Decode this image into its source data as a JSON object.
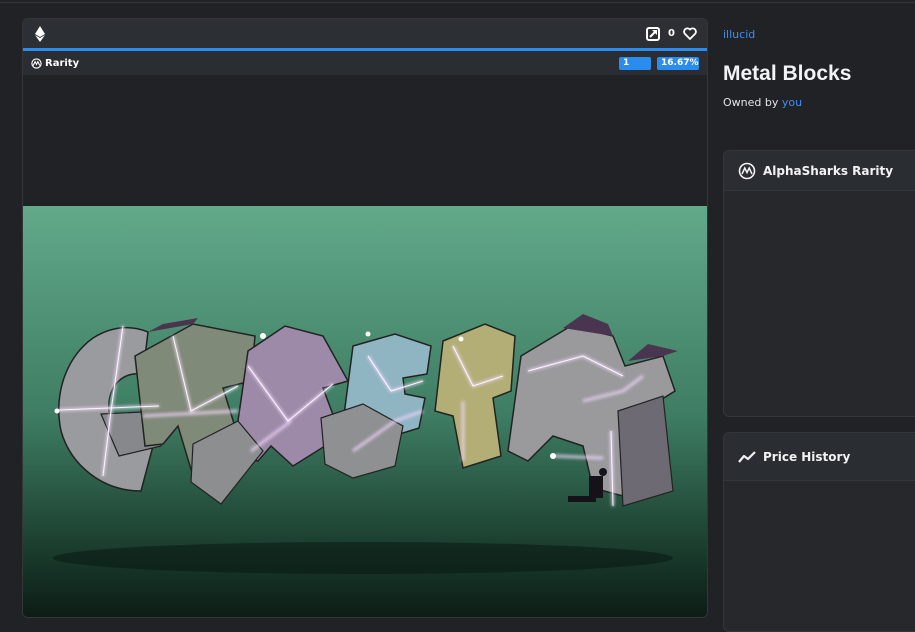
{
  "card": {
    "favorites_count": "0",
    "rarity_label": "Rarity",
    "rarity_rank": "1",
    "rarity_percent": "16.67%"
  },
  "item": {
    "collection": "illucid",
    "title": "Metal Blocks",
    "owned_by_label": "Owned by",
    "owner": "you"
  },
  "panels": {
    "rarity_title": "AlphaSharks Rarity",
    "price_history_title": "Price History"
  },
  "colors": {
    "accent": "#2b8cf0",
    "link": "#3b8ff5",
    "background": "#202225"
  },
  "icons": [
    "ethereum-icon",
    "external-link-icon",
    "heart-icon",
    "alphasharks-icon",
    "trend-line-icon"
  ]
}
